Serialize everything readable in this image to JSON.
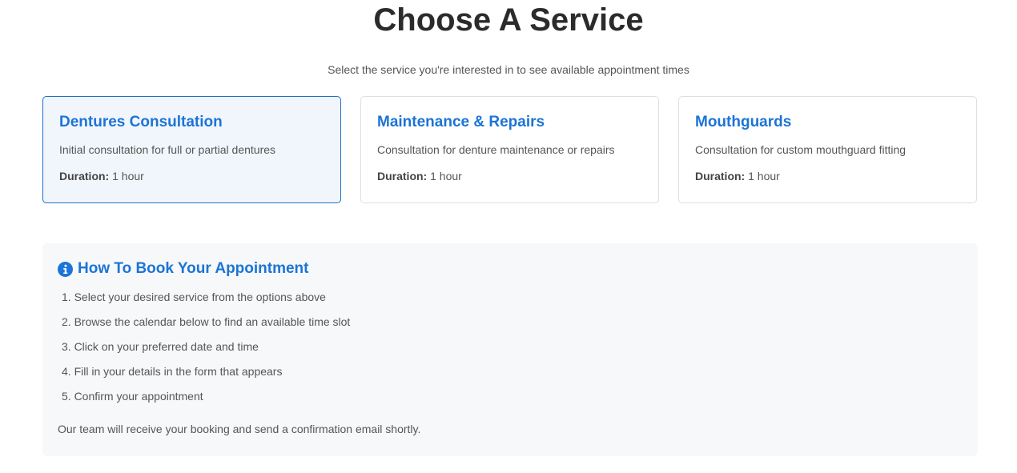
{
  "header": {
    "title": "Choose A Service",
    "subtitle": "Select the service you're interested in to see available appointment times"
  },
  "services": [
    {
      "title": "Dentures Consultation",
      "description": "Initial consultation for full or partial dentures",
      "duration_label": "Duration:",
      "duration_value": "1 hour",
      "selected": true
    },
    {
      "title": "Maintenance & Repairs",
      "description": "Consultation for denture maintenance or repairs",
      "duration_label": "Duration:",
      "duration_value": "1 hour",
      "selected": false
    },
    {
      "title": "Mouthguards",
      "description": "Consultation for custom mouthguard fitting",
      "duration_label": "Duration:",
      "duration_value": "1 hour",
      "selected": false
    }
  ],
  "booking_info": {
    "icon": "info-icon",
    "title": "How To Book Your Appointment",
    "steps": [
      "1. Select your desired service from the options above",
      "2. Browse the calendar below to find an available time slot",
      "3. Click on your preferred date and time",
      "4. Fill in your details in the form that appears",
      "5. Confirm your appointment"
    ],
    "note": "Our team will receive your booking and send a confirmation email shortly."
  },
  "colors": {
    "accent": "#1c74d6",
    "selected_border": "#1c6fc4",
    "selected_background": "#f1f6fc",
    "info_background": "#f6f8fa"
  }
}
